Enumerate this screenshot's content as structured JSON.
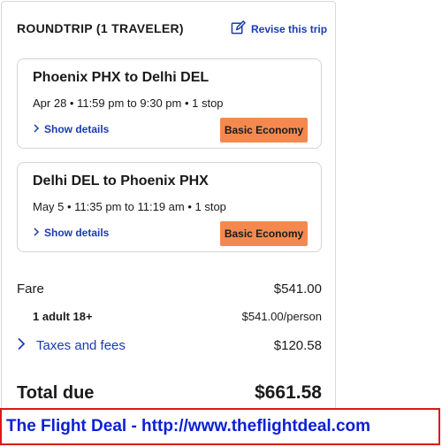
{
  "header": {
    "title": "ROUNDTRIP (1 TRAVELER)",
    "revise_label": "Revise this trip"
  },
  "flights": [
    {
      "route": "Phoenix PHX to Delhi DEL",
      "times": "Apr 28 • 11:59 pm to 9:30 pm • 1 stop",
      "details_label": "Show details",
      "fare_class": "Basic Economy"
    },
    {
      "route": "Delhi DEL to Phoenix PHX",
      "times": "May 5 • 11:35 pm to 11:19 am • 1 stop",
      "details_label": "Show details",
      "fare_class": "Basic Economy"
    }
  ],
  "pricing": {
    "fare_label": "Fare",
    "fare_value": "$541.00",
    "adult_label": "1 adult 18+",
    "adult_value": "$541.00/person",
    "taxes_label": "Taxes and fees",
    "taxes_value": "$120.58",
    "total_label": "Total due",
    "total_value": "$661.58"
  },
  "banner": {
    "text": "The Flight Deal - http://www.theflightdeal.com"
  },
  "colors": {
    "link": "#1a3bb3",
    "badge": "#f4894f",
    "banner_border": "#e0141b",
    "banner_text": "#0a1fd6"
  },
  "icons": {
    "revise": "edit-icon",
    "details": "chevron-right-icon"
  }
}
